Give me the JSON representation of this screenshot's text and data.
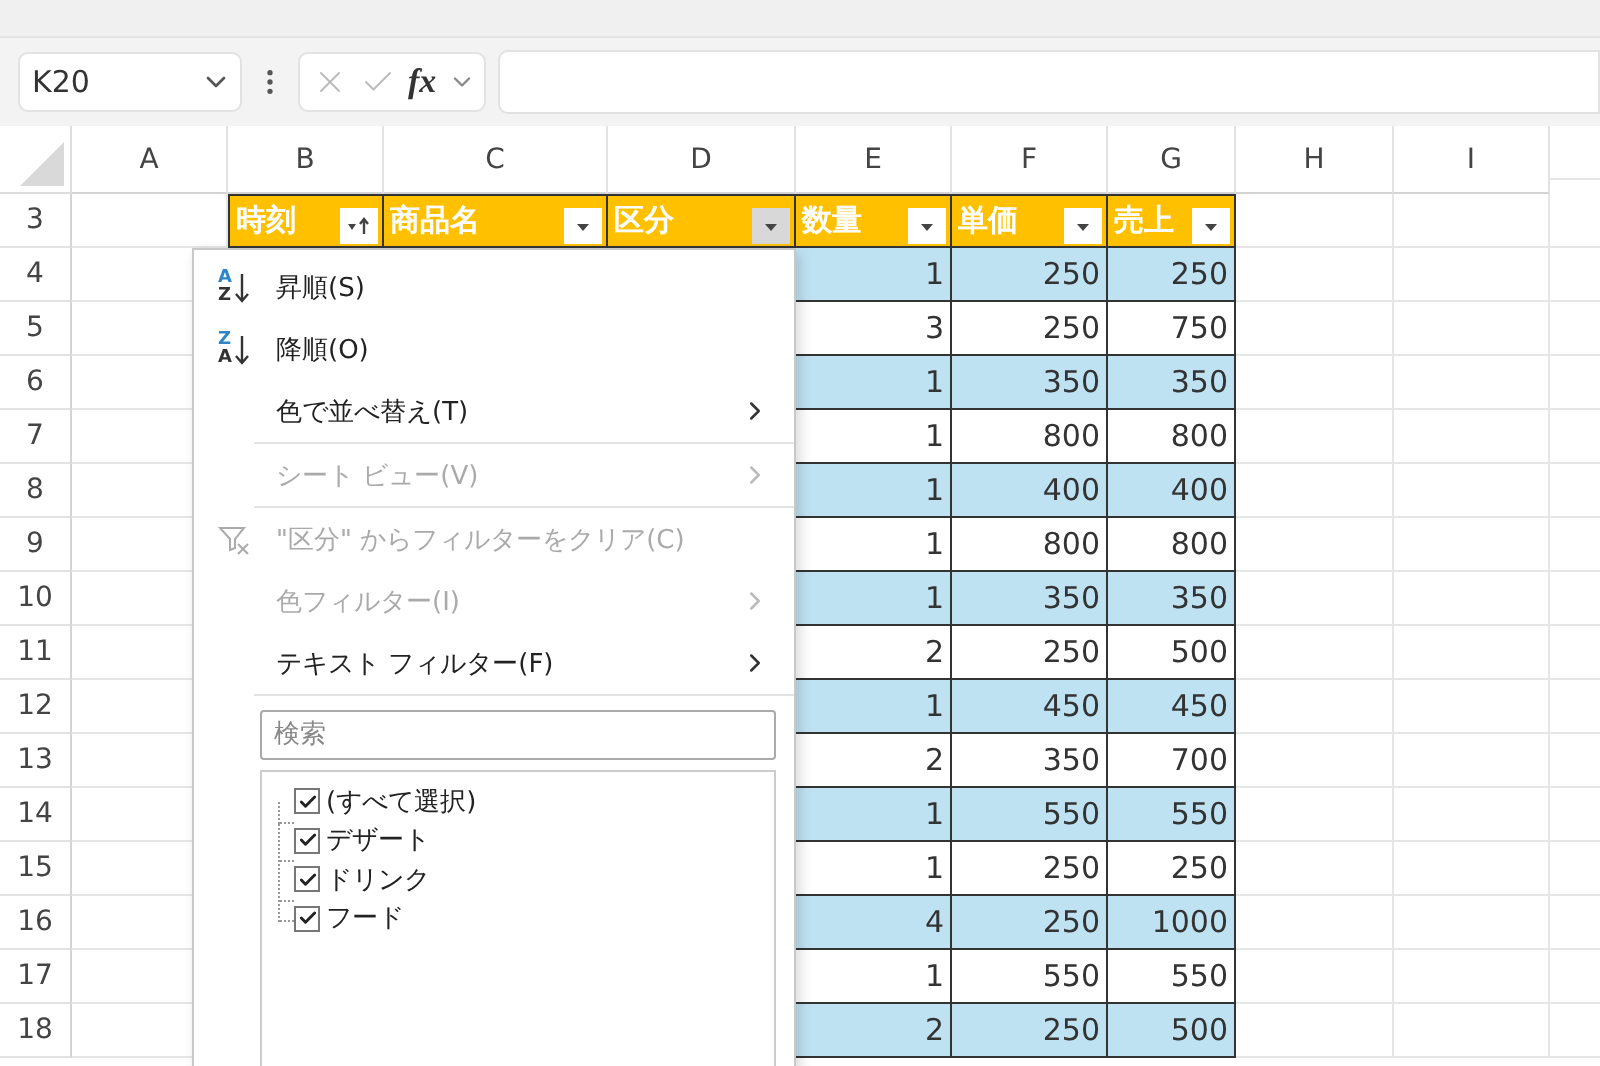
{
  "name_box": {
    "value": "K20"
  },
  "formula_bar": {
    "fx_label": "fx"
  },
  "columns": [
    "A",
    "B",
    "C",
    "D",
    "E",
    "F",
    "G",
    "H",
    "I"
  ],
  "row_numbers": [
    "3",
    "4",
    "5",
    "6",
    "7",
    "8",
    "9",
    "10",
    "11",
    "12",
    "13",
    "14",
    "15",
    "16",
    "17",
    "18"
  ],
  "table": {
    "headers": [
      {
        "label": "時刻",
        "sorted": true,
        "filter_open": false
      },
      {
        "label": "商品名",
        "sorted": false,
        "filter_open": false
      },
      {
        "label": "区分",
        "sorted": false,
        "filter_open": true
      },
      {
        "label": "数量",
        "sorted": false,
        "filter_open": false
      },
      {
        "label": "単価",
        "sorted": false,
        "filter_open": false
      },
      {
        "label": "売上",
        "sorted": false,
        "filter_open": false
      }
    ],
    "rows": [
      {
        "shaded": true,
        "values": [
          "1",
          "250",
          "250"
        ]
      },
      {
        "shaded": false,
        "values": [
          "3",
          "250",
          "750"
        ]
      },
      {
        "shaded": true,
        "values": [
          "1",
          "350",
          "350"
        ]
      },
      {
        "shaded": false,
        "values": [
          "1",
          "800",
          "800"
        ]
      },
      {
        "shaded": true,
        "values": [
          "1",
          "400",
          "400"
        ]
      },
      {
        "shaded": false,
        "values": [
          "1",
          "800",
          "800"
        ]
      },
      {
        "shaded": true,
        "values": [
          "1",
          "350",
          "350"
        ]
      },
      {
        "shaded": false,
        "values": [
          "2",
          "250",
          "500"
        ]
      },
      {
        "shaded": true,
        "values": [
          "1",
          "450",
          "450"
        ]
      },
      {
        "shaded": false,
        "values": [
          "2",
          "350",
          "700"
        ]
      },
      {
        "shaded": true,
        "values": [
          "1",
          "550",
          "550"
        ]
      },
      {
        "shaded": false,
        "values": [
          "1",
          "250",
          "250"
        ]
      },
      {
        "shaded": true,
        "values": [
          "4",
          "250",
          "1000"
        ]
      },
      {
        "shaded": false,
        "values": [
          "1",
          "550",
          "550"
        ]
      },
      {
        "shaded": true,
        "values": [
          "2",
          "250",
          "500"
        ]
      }
    ]
  },
  "filter_menu": {
    "items": [
      {
        "kind": "sort",
        "label": "昇順(S)",
        "icon_top": "A",
        "icon_bottom": "Z",
        "disabled": false
      },
      {
        "kind": "sort",
        "label": "降順(O)",
        "icon_top": "Z",
        "icon_bottom": "A",
        "disabled": false
      },
      {
        "kind": "submenu",
        "label": "色で並べ替え(T)",
        "disabled": false
      },
      {
        "kind": "separator"
      },
      {
        "kind": "submenu",
        "label": "シート ビュー(V)",
        "disabled": true
      },
      {
        "kind": "separator"
      },
      {
        "kind": "clear",
        "label": "\"区分\" からフィルターをクリア(C)",
        "disabled": true
      },
      {
        "kind": "submenu",
        "label": "色フィルター(I)",
        "disabled": true
      },
      {
        "kind": "submenu",
        "label": "テキスト フィルター(F)",
        "disabled": false
      },
      {
        "kind": "separator"
      }
    ],
    "search": {
      "placeholder": "検索"
    },
    "values": [
      {
        "label": "(すべて選択)",
        "checked": true
      },
      {
        "label": "デザート",
        "checked": true
      },
      {
        "label": "ドリンク",
        "checked": true
      },
      {
        "label": "フード",
        "checked": true
      }
    ]
  }
}
